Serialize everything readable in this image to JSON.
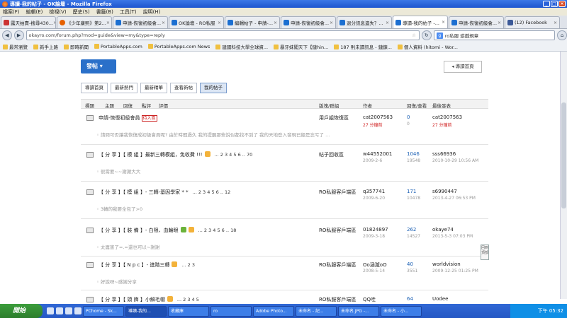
{
  "window": {
    "title": "導讀-我的帖子 - OK論壇 - Mozilla Firefox",
    "min": "_",
    "max": "□",
    "close": "×"
  },
  "menu": [
    "檔案(F)",
    "編輯(E)",
    "檢視(V)",
    "歷史(S)",
    "書籤(B)",
    "工具(T)",
    "說明(H)"
  ],
  "tabs": [
    {
      "label": "露天拍賣-搜尋430...",
      "icon": "page-icon",
      "active": false
    },
    {
      "label": "《少年康熙》第2...",
      "icon": "firefox-icon",
      "active": false
    },
    {
      "label": "申請-恢復初級會...",
      "icon": "k-site-icon",
      "active": false
    },
    {
      "label": "OK論壇 - RO私服",
      "icon": "k-site-icon",
      "active": false
    },
    {
      "label": "編輯帖子 - 申請-...",
      "icon": "k-site-icon",
      "active": false
    },
    {
      "label": "申請-恢復初級會...",
      "icon": "k-site-icon",
      "active": false
    },
    {
      "label": "退分訊息遺失？...",
      "icon": "k-site-icon",
      "active": false
    },
    {
      "label": "導讀-我的帖子 -...",
      "icon": "k-site-icon",
      "active": true
    },
    {
      "label": "申請-恢復初級會...",
      "icon": "k-site-icon",
      "active": false
    },
    {
      "label": "(12) Facebook",
      "icon": "facebook-icon",
      "active": false
    }
  ],
  "nav": {
    "url": "okayro.com/forum.php?mod=guide&view=my&type=reply",
    "search": "ro私服 遊戲規章",
    "back": "◀",
    "forward": "▶",
    "reload": "↻",
    "home": "⌂",
    "bookmark_star": "☆",
    "search_engine": "g"
  },
  "bookmarks": [
    "最常瀏覽",
    "新手上路",
    "即時新聞",
    "PortableApps.com",
    "PortableApps.com News",
    "建國科技大學全球資...",
    "暴牙妹闖天下【鏈hin...",
    "187 則未讀訊息 - 鏈鍊...",
    "個人資料 (hitomi - Wor..."
  ],
  "page": {
    "post_button": "發帖 ▾",
    "guide_home": "◂ 導讀首頁",
    "subtabs": [
      {
        "label": "導讀首頁",
        "active": false
      },
      {
        "label": "最新熱門",
        "active": false
      },
      {
        "label": "最新精華",
        "active": false
      },
      {
        "label": "查看新帖",
        "active": false
      },
      {
        "label": "我的帖子",
        "active": true
      }
    ],
    "columns": {
      "title": "標題",
      "theme": "主題",
      "reply": "回復",
      "point": "點評",
      "rate": "評價",
      "forum": "版塊/群組",
      "author": "作者",
      "replies_views": "回復/查看",
      "last_post": "最後發表"
    },
    "back_to_top": "回到頂部",
    "threads": [
      {
        "title": "申請-恢復初級會員",
        "tag": "待入區",
        "pages": "",
        "forum": "用戶組恢復區",
        "author": "cat2007563",
        "date": "27 分鐘前",
        "date_red": true,
        "replies": "0",
        "views": "0",
        "last_user": "cat2007563",
        "last_date": "27 分鐘前",
        "last_red": true,
        "excerpt": "◦ 請問可否讓我恢復成初級會員呢? 由於時間過久 我的提醒那些說似都找不到了 我的天地登入發現已經是忘亏了 ..."
      },
      {
        "title": "【 分 享 】【 模 組 】最新三轉模組，免收費 !!!",
        "tag": "",
        "pages": "... 2 3 4 5 6 .. 70",
        "forum": "帖子回收區",
        "author": "w44552001",
        "date": "2009-2-6",
        "date_red": false,
        "replies": "1046",
        "views": "19548",
        "last_user": "sss66936",
        "last_date": "2010-10-29 10:56 AM",
        "last_red": false,
        "excerpt": "◦ 很需要~~謝謝大大"
      },
      {
        "title": "【 分 享 】【 模 組 】- 三轉-基因學家 * *",
        "tag": "",
        "pages": "... 2 3 4 5 6 .. 12",
        "forum": "RO私服客戶端區",
        "author": "q357741",
        "date": "2009-6-20",
        "date_red": false,
        "replies": "171",
        "views": "10478",
        "last_user": "s6990447",
        "last_date": "2013-4-27 06:53 PM",
        "last_red": false,
        "excerpt": "◦ 3轉的我要全包了>0"
      },
      {
        "title": "【 分 享 】【 裝 備 】- 白限、血輪眼",
        "tag": "",
        "pages": "... 2 3 4 5 6 .. 18",
        "forum": "RO私服客戶端區",
        "author": "01824897",
        "date": "2009-3-18",
        "date_red": false,
        "replies": "262",
        "views": "14527",
        "last_user": "okaye74",
        "last_date": "2013-5-3 07:03 PM",
        "last_red": false,
        "excerpt": "◦ 太厲害了=.=還也可以~謝謝"
      },
      {
        "title": "【 分 享 】【 N p c 】- 進階三轉",
        "tag": "",
        "pages": "... 2 3",
        "forum": "RO私服客戶端區",
        "author": "Oo涵瀧oO",
        "date": "2008-5-14",
        "date_red": false,
        "replies": "40",
        "views": "3551",
        "last_user": "worldvision",
        "last_date": "2009-12-25 01:25 PM",
        "last_red": false,
        "excerpt": "◦ 好說呀~感謝分享"
      },
      {
        "title": "【 分 享 】【 頭 飾 】小解毛帽",
        "tag": "",
        "pages": "... 2 3 4 5",
        "forum": "RO私服客戶端區",
        "author": "QQ哇",
        "date": "",
        "date_red": false,
        "replies": "64",
        "views": "",
        "last_user": "Uodee",
        "last_date": "",
        "last_red": false,
        "excerpt": ""
      }
    ]
  },
  "taskbar": {
    "start": "開始",
    "tasks": [
      {
        "label": "PChome - Sk...",
        "active": false
      },
      {
        "label": "導讀-我的...",
        "active": true
      },
      {
        "label": "收藏庫",
        "active": false
      },
      {
        "label": "ro",
        "active": false
      },
      {
        "label": "Adobe Photo...",
        "active": false
      },
      {
        "label": "未命名 - 記...",
        "active": false
      },
      {
        "label": "未命名.JPG -...",
        "active": false
      },
      {
        "label": "未命名 - 小...",
        "active": false
      }
    ],
    "clock": "下午 05:32"
  }
}
